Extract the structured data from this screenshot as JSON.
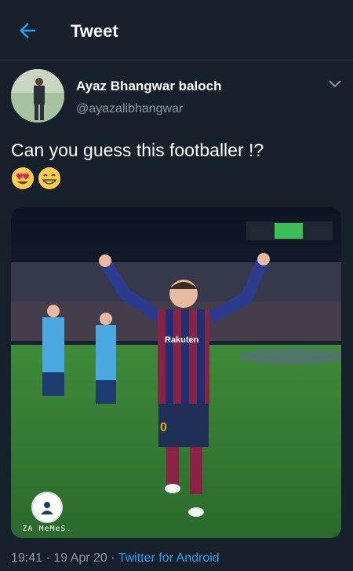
{
  "header": {
    "title": "Tweet",
    "back_icon": "arrow-left-icon"
  },
  "tweet": {
    "author_name": "Ayaz Bhangwar baloch",
    "handle": "@ayazalibhangwar",
    "text": "Can you guess this footballer !?",
    "emojis": [
      "heart-eyes-emoji",
      "grinning-emoji"
    ],
    "media": {
      "description_icon": "photo-icon",
      "jersey_text": "Rakuten",
      "jersey_number": "0",
      "watermark": "ZA MeMeS."
    },
    "time": "19:41",
    "date": "19 Apr 20",
    "separator": "·",
    "source": "Twitter for Android"
  },
  "colors": {
    "background": "#15202b",
    "accent": "#1da1f2",
    "secondary_text": "#8899a6"
  }
}
